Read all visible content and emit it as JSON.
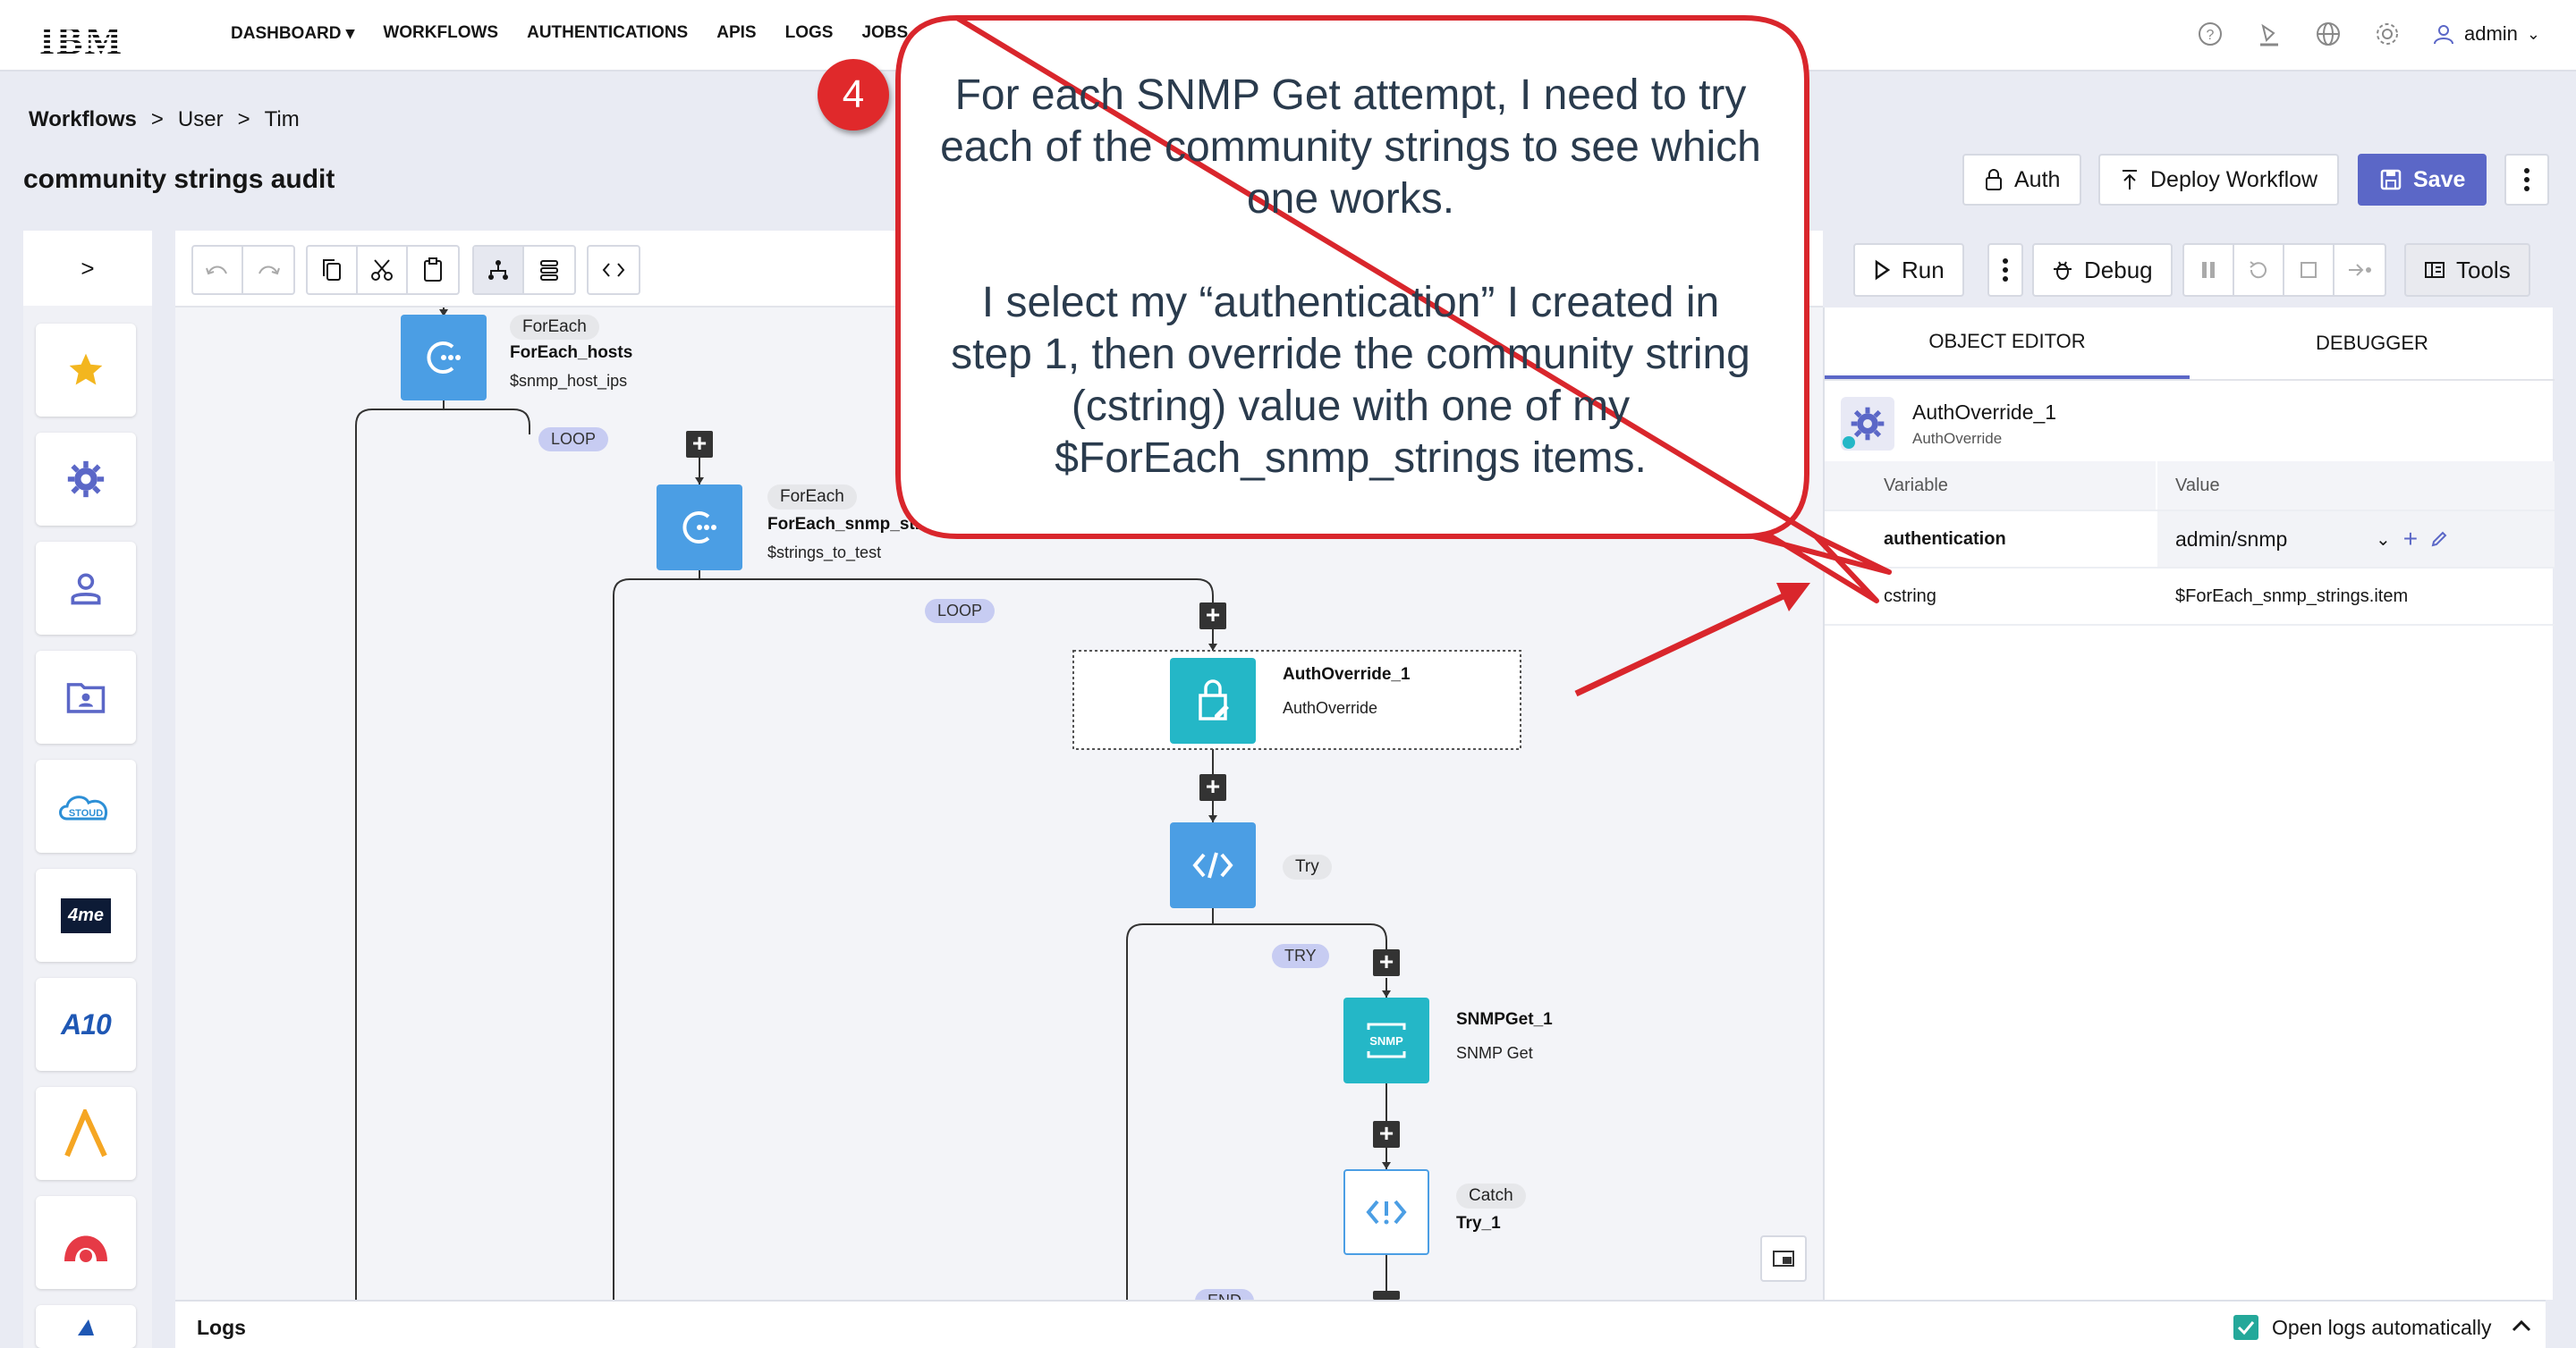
{
  "nav": {
    "logo": "IBM",
    "items": [
      "DASHBOARD",
      "WORKFLOWS",
      "AUTHENTICATIONS",
      "APIS",
      "LOGS",
      "JOBS"
    ],
    "dashboard_caret": "▾",
    "user": "admin"
  },
  "breadcrumb": {
    "root": "Workflows",
    "sep": ">",
    "level1": "User",
    "level2": "Tim"
  },
  "page": {
    "title": "community strings audit"
  },
  "header_buttons": {
    "auth": "Auth",
    "deploy": "Deploy Workflow",
    "save": "Save"
  },
  "toolbar": {
    "run": "Run",
    "debug": "Debug",
    "tools": "Tools"
  },
  "sidebar": {
    "toggle": ">",
    "items": [
      {
        "icon": "star-icon"
      },
      {
        "icon": "gear-icon"
      },
      {
        "icon": "user-icon"
      },
      {
        "icon": "folder-user-icon"
      },
      {
        "icon": "cloud-icon",
        "text": "STOUD"
      },
      {
        "icon": "4me-logo",
        "text": "4me"
      },
      {
        "icon": "a10-logo",
        "text": "A10"
      },
      {
        "icon": "ansible-logo"
      },
      {
        "icon": "arch-logo"
      }
    ]
  },
  "canvas": {
    "nodes": {
      "foreach_hosts": {
        "tag": "ForEach",
        "title": "ForEach_hosts",
        "sub": "$snmp_host_ips"
      },
      "foreach_strings": {
        "tag": "ForEach",
        "title": "ForEach_snmp_string",
        "sub": "$strings_to_test"
      },
      "authoverride": {
        "title": "AuthOverride_1",
        "sub": "AuthOverride"
      },
      "try": {
        "tag": "Try"
      },
      "snmpget": {
        "title": "SNMPGet_1",
        "sub": "SNMP Get",
        "icon_text": "SNMP"
      },
      "catch": {
        "tag": "Catch",
        "title": "Try_1"
      }
    },
    "loop_label_1": "LOOP",
    "loop_label_2": "LOOP",
    "try_label": "TRY",
    "end_label": "END"
  },
  "logs": {
    "title": "Logs",
    "auto_label": "Open logs automatically",
    "auto_checked": true
  },
  "right_panel": {
    "tabs": [
      "OBJECT EDITOR",
      "DEBUGGER"
    ],
    "object": {
      "name": "AuthOverride_1",
      "type": "AuthOverride"
    },
    "table": {
      "headers": [
        "Variable",
        "Value"
      ],
      "rows": [
        {
          "variable": "authentication",
          "value": "admin/snmp"
        },
        {
          "variable": "cstring",
          "value": "$ForEach_snmp_strings.item"
        }
      ]
    }
  },
  "callout": {
    "badge": "4",
    "line1": "For each SNMP Get attempt, I need to try",
    "line2": "each of the community strings to see which",
    "line3": "one works.",
    "line4": "I select my “authentication” I created in",
    "line5": "step 1, then override the community string",
    "line6": "(cstring) value with one of my",
    "line7": "$ForEach_snmp_strings items."
  },
  "colors": {
    "accent": "#5b67c7",
    "node_blue": "#4b9ee4",
    "node_teal": "#24b7c7",
    "callout_red": "#e0292b"
  }
}
